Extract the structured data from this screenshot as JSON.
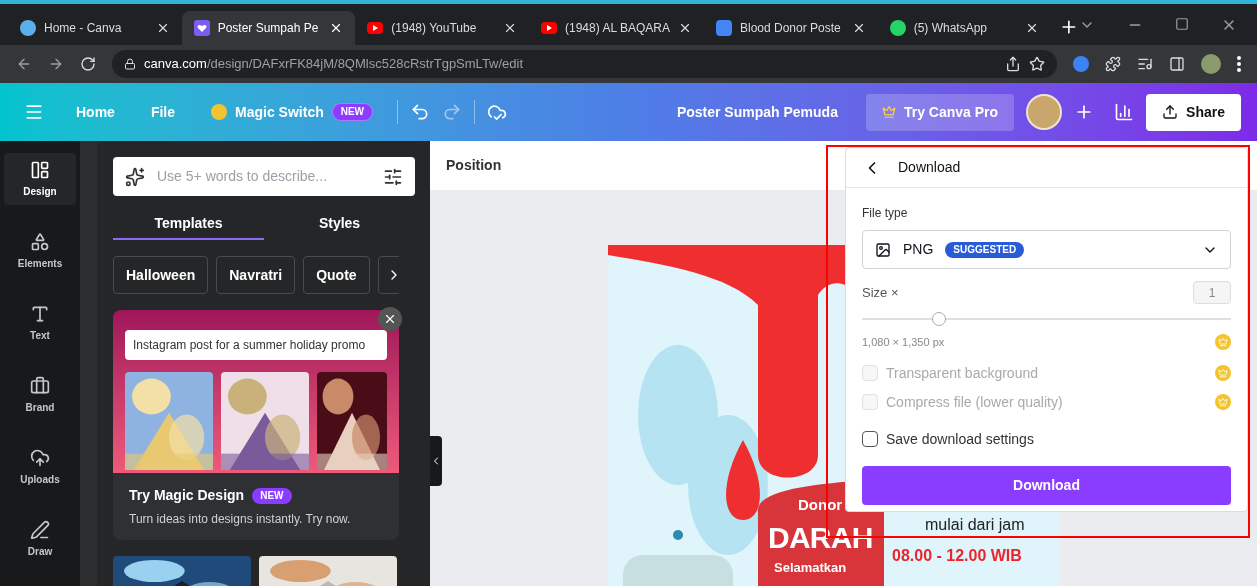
{
  "browser": {
    "tabs": [
      {
        "title": "Home - Canva",
        "kind": "canva",
        "selected": false
      },
      {
        "title": "Poster Sumpah Pe",
        "kind": "design",
        "selected": true
      },
      {
        "title": "(1948) YouTube",
        "kind": "video",
        "selected": false
      },
      {
        "title": "(1948) AL BAQARA",
        "kind": "video",
        "selected": false
      },
      {
        "title": "Blood Donor Poste",
        "kind": "doc",
        "selected": false
      },
      {
        "title": "(5) WhatsApp",
        "kind": "chat",
        "selected": false
      }
    ],
    "url_host": "canva.com",
    "url_path": "/design/DAFxrFK84jM/8QMlsc528cRstrTgpSmLTw/edit"
  },
  "header": {
    "menu": [
      {
        "label": "Home"
      },
      {
        "label": "File"
      }
    ],
    "magic_switch": {
      "label": "Magic Switch",
      "badge": "NEW"
    },
    "doc_title": "Poster Sumpah Pemuda",
    "pro_button": "Try Canva Pro",
    "share": "Share"
  },
  "rail": [
    {
      "label": "Design",
      "kind": "design",
      "selected": true
    },
    {
      "label": "Elements",
      "kind": "elements",
      "selected": false
    },
    {
      "label": "Text",
      "kind": "text",
      "selected": false
    },
    {
      "label": "Brand",
      "kind": "brand",
      "selected": false
    },
    {
      "label": "Uploads",
      "kind": "uploads",
      "selected": false
    },
    {
      "label": "Draw",
      "kind": "draw",
      "selected": false
    }
  ],
  "panel": {
    "search": {
      "placeholder": "Use 5+ words to describe..."
    },
    "tabs": [
      {
        "label": "Templates",
        "selected": true
      },
      {
        "label": "Styles",
        "selected": false
      }
    ],
    "chips": [
      "Halloween",
      "Navratri",
      "Quote"
    ],
    "promo": {
      "prompt": "Instagram post for a summer holiday promo",
      "title": "Try Magic Design",
      "badge": "NEW",
      "text": "Turn ideas into designs instantly. Try now."
    }
  },
  "canvas": {
    "toolbar": "Position",
    "poster": {
      "texts": [
        {
          "kind": "donor",
          "text": "Donor"
        },
        {
          "kind": "darah",
          "text": "DARAH"
        },
        {
          "kind": "save",
          "text": "Selamatkan"
        },
        {
          "kind": "start",
          "text": "mulai dari jam"
        },
        {
          "kind": "time",
          "text": "08.00 - 12.00 WIB"
        }
      ]
    }
  },
  "download": {
    "title": "Download",
    "file_type_label": "File type",
    "file_type": "PNG",
    "badge": "SUGGESTED",
    "size_label": "Size ×",
    "size_value": "1",
    "size_slider": {
      "level": 0.21
    },
    "dimensions": "1,080 × 1,350 px",
    "dimensions_pro": true,
    "options": [
      {
        "label": "Transparent background",
        "checked": false,
        "disabled": true,
        "pro": true
      },
      {
        "label": "Compress file (lower quality)",
        "checked": false,
        "disabled": true,
        "pro": true
      },
      {
        "label": "Save download settings",
        "checked": false,
        "disabled": false,
        "pro": false
      }
    ],
    "button": "Download",
    "highlighted": true
  }
}
